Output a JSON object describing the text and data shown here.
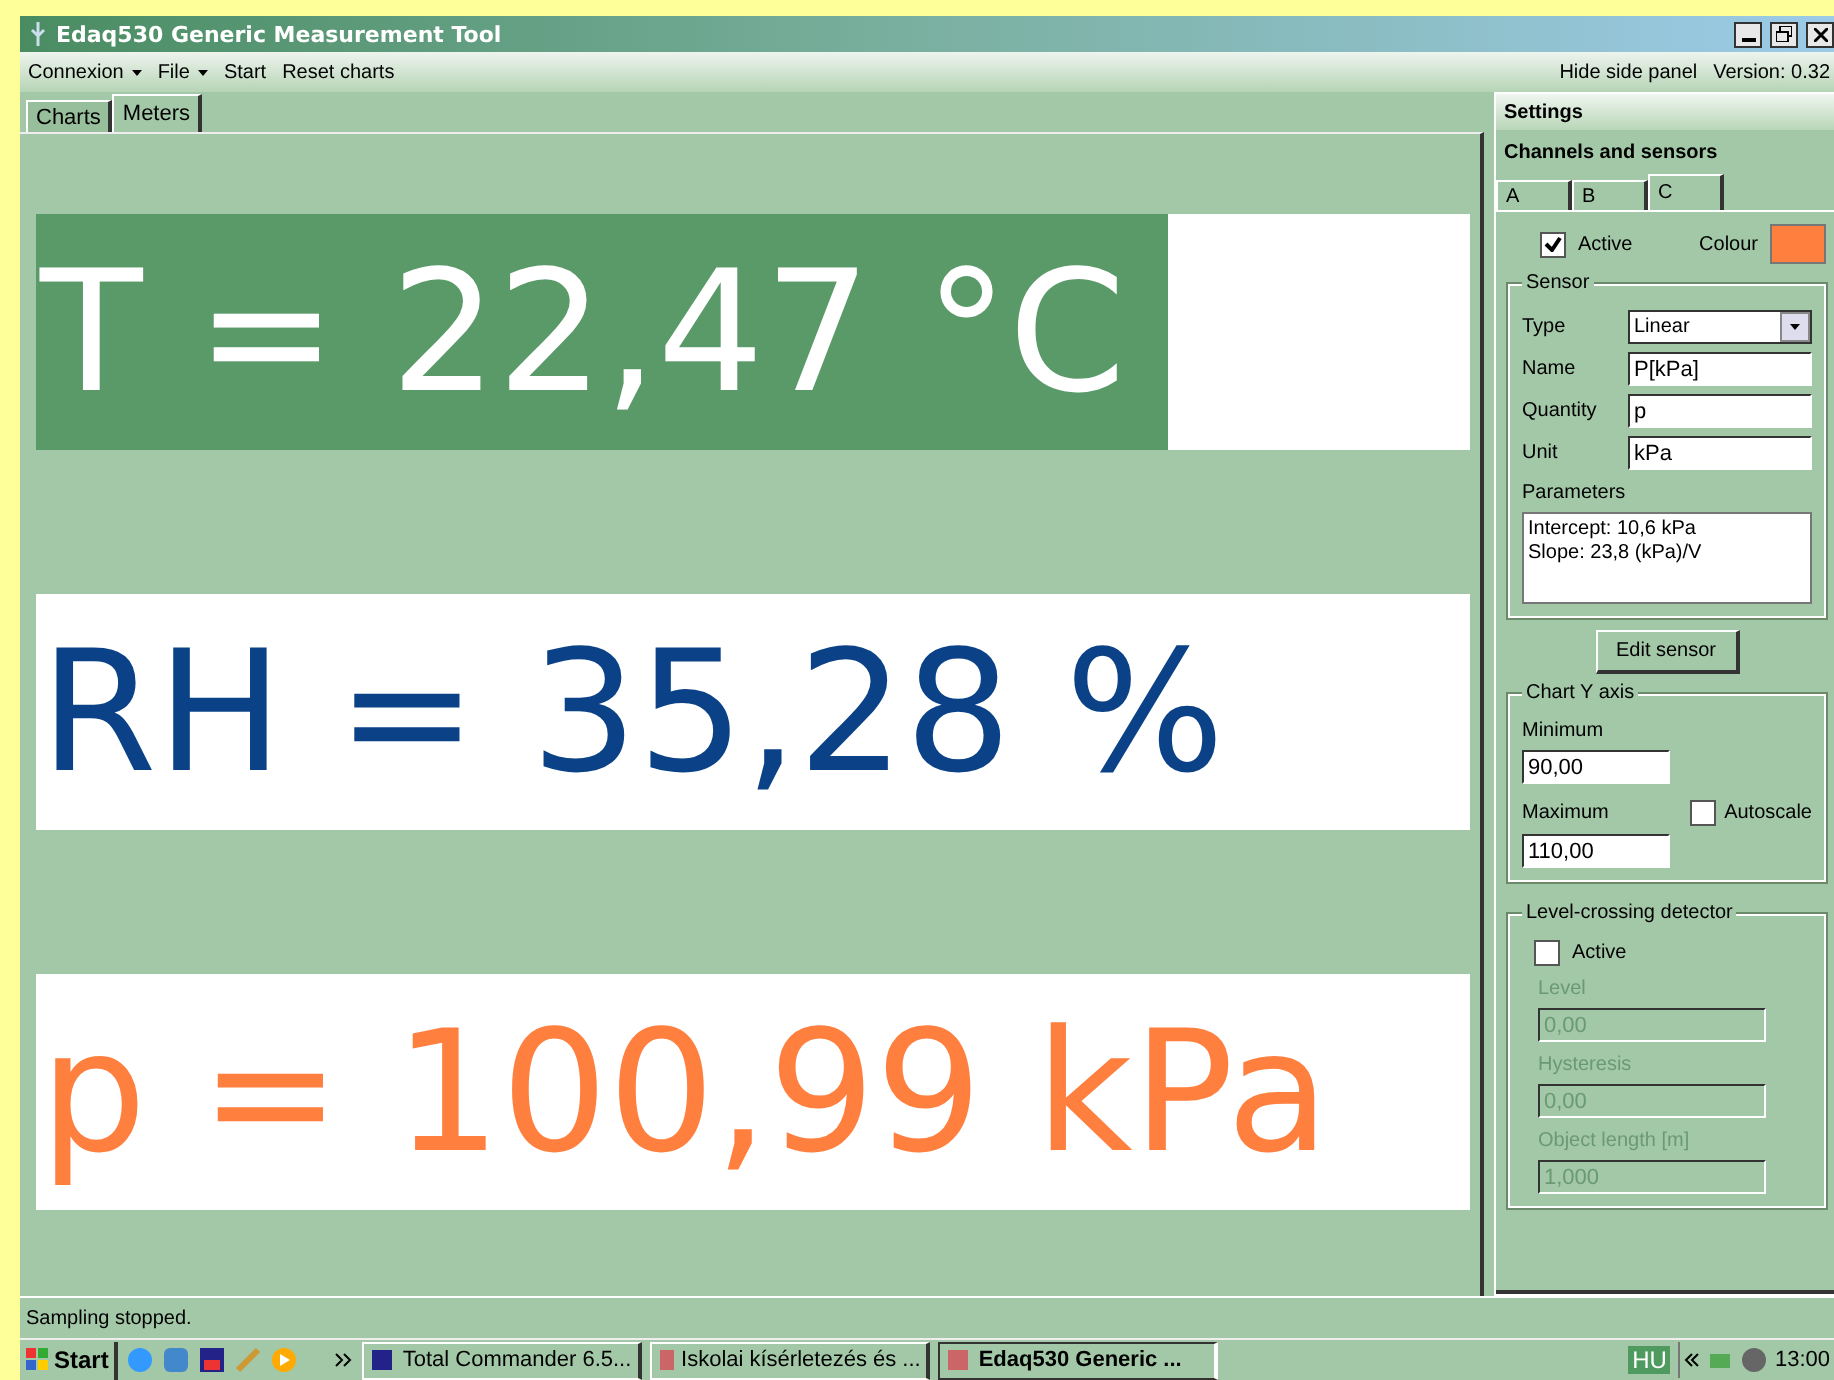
{
  "window": {
    "title": "Edaq530 Generic Measurement Tool"
  },
  "menu": [
    {
      "label": "Connexion",
      "dropdown": true
    },
    {
      "label": "File",
      "dropdown": true
    },
    {
      "label": "Start",
      "dropdown": false
    },
    {
      "label": "Reset charts",
      "dropdown": false
    }
  ],
  "menu_right": [
    "Hide side panel",
    "Version: 0.32"
  ],
  "tabs": [
    {
      "label": "Charts",
      "selected": false
    },
    {
      "label": "Meters",
      "selected": true
    }
  ],
  "meters": [
    {
      "text": "T = 22,47 °C",
      "color": "#5a9a68",
      "level": 0.79
    },
    {
      "text": "RH = 35,28 %",
      "color": "#0b4287"
    },
    {
      "text": "p = 100,99 kPa",
      "color": "#ff7f3f"
    }
  ],
  "side_panel": {
    "title": "Settings",
    "section": "Channels and sensors",
    "channel_tabs": [
      {
        "label": "A",
        "selected": false
      },
      {
        "label": "B",
        "selected": false
      },
      {
        "label": "C",
        "selected": true
      }
    ],
    "active": {
      "label": "Active",
      "checked": true
    },
    "colour": {
      "label": "Colour",
      "color": "#ff7f3f"
    },
    "sensor": {
      "title": "Sensor",
      "fields": [
        {
          "label": "Type",
          "value": "Linear",
          "kind": "select"
        },
        {
          "label": "Name",
          "value": "P[kPa]",
          "kind": "text"
        },
        {
          "label": "Quantity",
          "value": "p",
          "kind": "text"
        },
        {
          "label": "Unit",
          "value": "kPa",
          "kind": "text"
        }
      ],
      "parameters_label": "Parameters",
      "parameters": [
        "Intercept: 10,6 kPa",
        "Slope: 23,8 (kPa)/V"
      ]
    },
    "edit_button": "Edit sensor",
    "chart_y_axis": {
      "title": "Chart Y axis",
      "minimum": {
        "label": "Minimum",
        "value": "90,00"
      },
      "maximum": {
        "label": "Maximum",
        "value": "110,00"
      },
      "autoscale": {
        "label": "Autoscale",
        "checked": false
      }
    },
    "level_detector": {
      "title": "Level-crossing detector",
      "active": {
        "label": "Active",
        "checked": false
      },
      "fields": [
        {
          "label": "Level",
          "value": "0,00",
          "disabled": true
        },
        {
          "label": "Hysteresis",
          "value": "0,00",
          "disabled": true
        },
        {
          "label": "Object length [m]",
          "value": "1,000",
          "disabled": true
        }
      ]
    }
  },
  "status_bar": "Sampling stopped.",
  "taskbar": {
    "start": "Start",
    "tasks": [
      {
        "label": "Total Commander 6.5...",
        "selected": false
      },
      {
        "label": "Iskolai kísérletezés és ...",
        "selected": false
      },
      {
        "label": "Edaq530 Generic ...",
        "selected": true
      }
    ],
    "language": "HU",
    "clock": "13:00"
  }
}
